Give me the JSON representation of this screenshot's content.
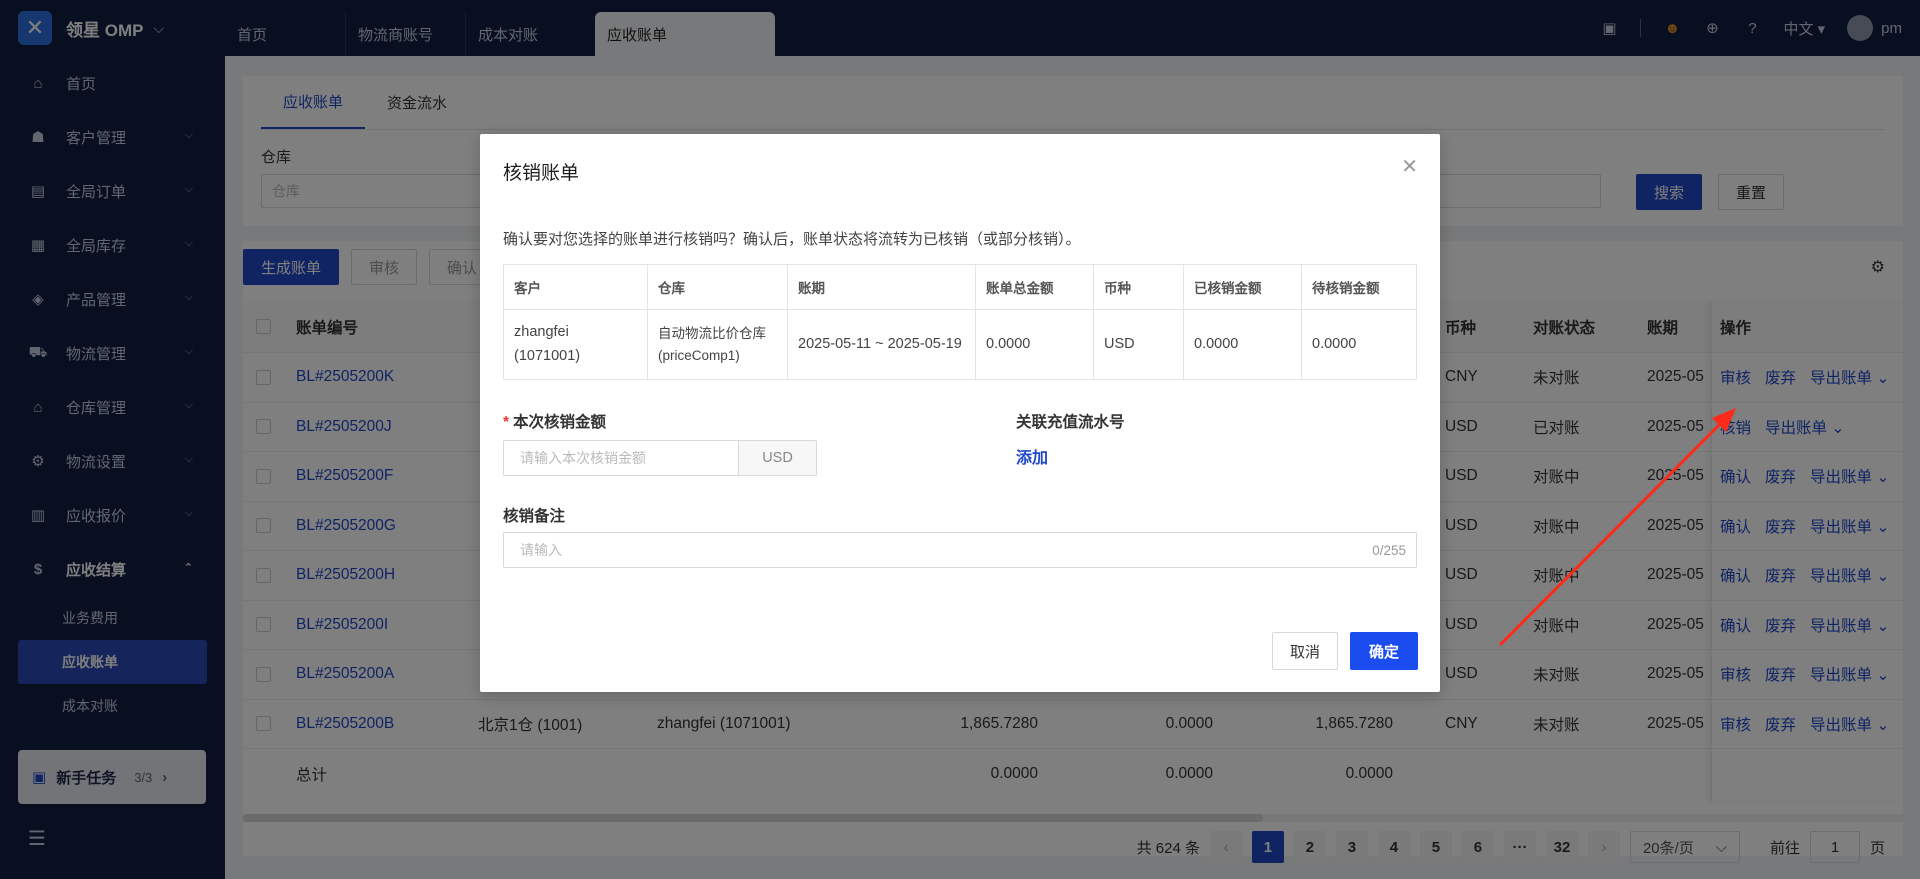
{
  "app": {
    "brand": "领星 OMP"
  },
  "top_tabs": [
    "首页",
    "物流商账号",
    "成本对账",
    "应收账单"
  ],
  "top_right": {
    "language": "中文",
    "user": "pm"
  },
  "sidebar": {
    "items": [
      {
        "label": "首页",
        "icon": "home-icon"
      },
      {
        "label": "客户管理",
        "icon": "users-icon"
      },
      {
        "label": "全局订单",
        "icon": "orders-icon"
      },
      {
        "label": "全局库存",
        "icon": "inventory-icon"
      },
      {
        "label": "产品管理",
        "icon": "product-icon"
      },
      {
        "label": "物流管理",
        "icon": "truck-icon"
      },
      {
        "label": "仓库管理",
        "icon": "warehouse-icon"
      },
      {
        "label": "物流设置",
        "icon": "logistics-settings-icon"
      },
      {
        "label": "应收报价",
        "icon": "quote-icon"
      },
      {
        "label": "应收结算",
        "icon": "dollar-icon"
      }
    ],
    "sub_items": [
      "业务费用",
      "应收账单",
      "成本对账"
    ],
    "new_task": {
      "label": "新手任务",
      "count": "3/3"
    }
  },
  "page": {
    "tabs": [
      "应收账单",
      "资金流水"
    ],
    "filter_label": "仓库",
    "filter_placeholder": "仓库",
    "search_button": "搜索",
    "reset_button": "重置",
    "action_buttons": [
      "生成账单",
      "审核",
      "确认"
    ]
  },
  "table": {
    "headers": {
      "id": "账单编号",
      "currency": "币种",
      "status": "对账状态",
      "period": "账期",
      "ops": "操作"
    },
    "rows": [
      {
        "id": "BL#2505200K",
        "currency": "CNY",
        "status": "未对账",
        "period": "2025-05",
        "ops": [
          "审核",
          "废弃",
          "导出账单 ⌄"
        ]
      },
      {
        "id": "BL#2505200J",
        "currency": "USD",
        "status": "已对账",
        "period": "2025-05",
        "ops": [
          "核销",
          "导出账单 ⌄"
        ]
      },
      {
        "id": "BL#2505200F",
        "currency": "USD",
        "status": "对账中",
        "period": "2025-05",
        "ops": [
          "确认",
          "废弃",
          "导出账单 ⌄"
        ]
      },
      {
        "id": "BL#2505200G",
        "currency": "USD",
        "status": "对账中",
        "period": "2025-05",
        "ops": [
          "确认",
          "废弃",
          "导出账单 ⌄"
        ]
      },
      {
        "id": "BL#2505200H",
        "currency": "USD",
        "status": "对账中",
        "period": "2025-05",
        "ops": [
          "确认",
          "废弃",
          "导出账单 ⌄"
        ]
      },
      {
        "id": "BL#2505200I",
        "currency": "USD",
        "status": "对账中",
        "period": "2025-05",
        "ops": [
          "确认",
          "废弃",
          "导出账单 ⌄"
        ]
      },
      {
        "id": "BL#2505200A",
        "currency": "USD",
        "status": "未对账",
        "period": "2025-05",
        "ops": [
          "审核",
          "废弃",
          "导出账单 ⌄"
        ]
      },
      {
        "id": "BL#2505200B",
        "warehouse": "北京1仓 (1001)",
        "customer": "zhangfei (1071001)",
        "total": "1,865.7280",
        "settled": "0.0000",
        "pending": "1,865.7280",
        "currency": "CNY",
        "status": "未对账",
        "period": "2025-05",
        "ops": [
          "审核",
          "废弃",
          "导出账单 ⌄"
        ]
      }
    ],
    "summary": {
      "label": "总计",
      "total": "0.0000",
      "settled": "0.0000",
      "pending": "0.0000"
    }
  },
  "pagination": {
    "total_text": "共 624 条",
    "pages": [
      "1",
      "2",
      "3",
      "4",
      "5",
      "6",
      "···",
      "32"
    ],
    "page_size": "20条/页",
    "goto_label": "前往",
    "goto_value": "1",
    "page_suffix": "页"
  },
  "modal": {
    "title": "核销账单",
    "description": "确认要对您选择的账单进行核销吗？确认后，账单状态将流转为已核销（或部分核销）。",
    "columns": [
      "客户",
      "仓库",
      "账期",
      "账单总金额",
      "币种",
      "已核销金额",
      "待核销金额"
    ],
    "row": {
      "customer": "zhangfei (1071001)",
      "warehouse": "自动物流比价仓库(priceComp1)",
      "period": "2025-05-11 ~ 2025-05-19",
      "total": "0.0000",
      "currency": "USD",
      "settled": "0.0000",
      "pending": "0.0000"
    },
    "amount_label": "本次核销金额",
    "amount_placeholder": "请输入本次核销金额",
    "amount_suffix": "USD",
    "related_label": "关联充值流水号",
    "add_link": "添加",
    "note_label": "核销备注",
    "note_placeholder": "请输入",
    "note_counter": "0/255",
    "cancel": "取消",
    "confirm": "确定"
  },
  "colors": {
    "primary": "#2149c9",
    "nav_bg": "#0f1e41",
    "annotation_arrow": "#ff2a1a"
  }
}
